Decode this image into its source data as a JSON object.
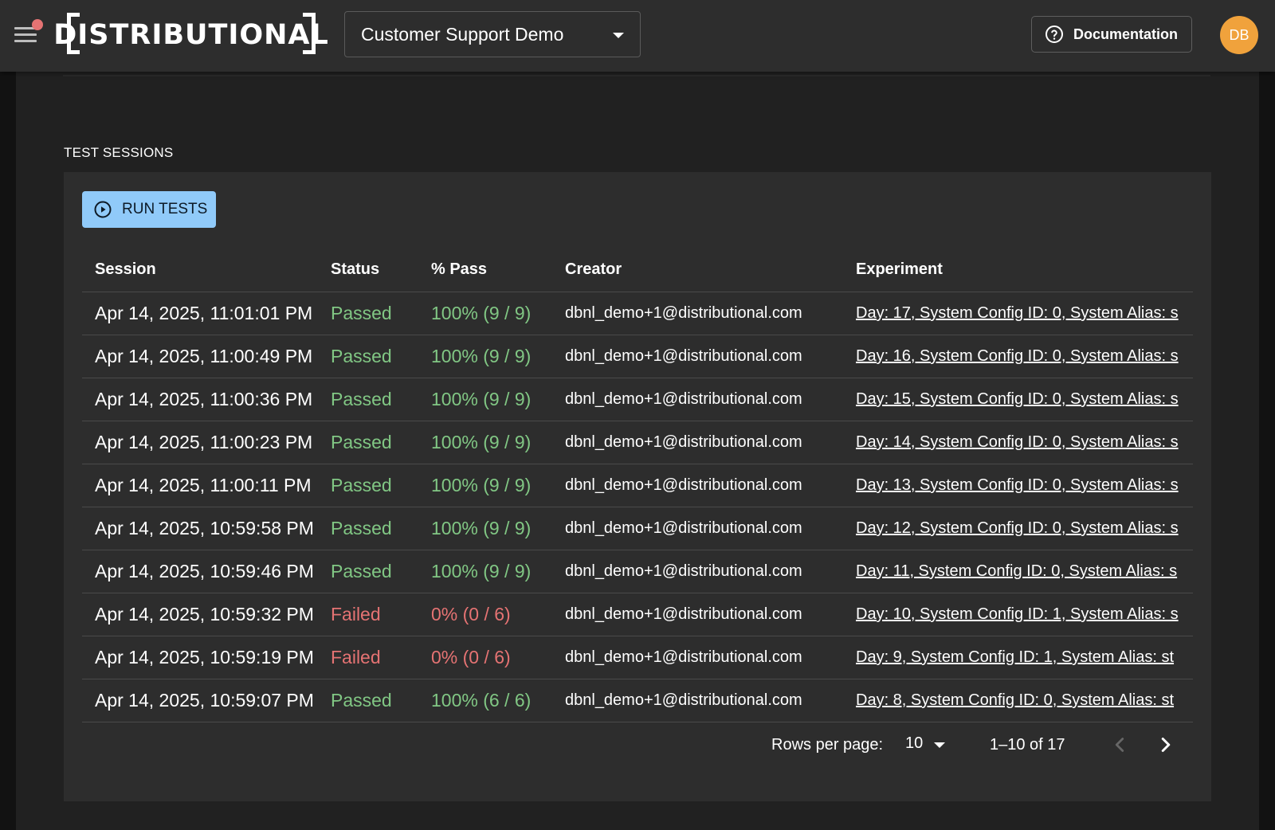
{
  "header": {
    "logo_text": "DISTRIBUTIONAL",
    "project": "Customer Support Demo",
    "docs_label": "Documentation",
    "avatar_initials": "DB"
  },
  "section": {
    "title": "TEST SESSIONS"
  },
  "run_button": {
    "label": "RUN TESTS"
  },
  "table": {
    "columns": [
      "Session",
      "Status",
      "% Pass",
      "Creator",
      "Experiment"
    ],
    "rows": [
      {
        "session": "Apr 14, 2025, 11:01:01 PM",
        "status": "Passed",
        "pass": "100% (9 / 9)",
        "creator": "dbnl_demo+1@distributional.com",
        "experiment": "Day: 17, System Config ID: 0, System Alias: s"
      },
      {
        "session": "Apr 14, 2025, 11:00:49 PM",
        "status": "Passed",
        "pass": "100% (9 / 9)",
        "creator": "dbnl_demo+1@distributional.com",
        "experiment": "Day: 16, System Config ID: 0, System Alias: s"
      },
      {
        "session": "Apr 14, 2025, 11:00:36 PM",
        "status": "Passed",
        "pass": "100% (9 / 9)",
        "creator": "dbnl_demo+1@distributional.com",
        "experiment": "Day: 15, System Config ID: 0, System Alias: s"
      },
      {
        "session": "Apr 14, 2025, 11:00:23 PM",
        "status": "Passed",
        "pass": "100% (9 / 9)",
        "creator": "dbnl_demo+1@distributional.com",
        "experiment": "Day: 14, System Config ID: 0, System Alias: s"
      },
      {
        "session": "Apr 14, 2025, 11:00:11 PM",
        "status": "Passed",
        "pass": "100% (9 / 9)",
        "creator": "dbnl_demo+1@distributional.com",
        "experiment": "Day: 13, System Config ID: 0, System Alias: s"
      },
      {
        "session": "Apr 14, 2025, 10:59:58 PM",
        "status": "Passed",
        "pass": "100% (9 / 9)",
        "creator": "dbnl_demo+1@distributional.com",
        "experiment": "Day: 12, System Config ID: 0, System Alias: s"
      },
      {
        "session": "Apr 14, 2025, 10:59:46 PM",
        "status": "Passed",
        "pass": "100% (9 / 9)",
        "creator": "dbnl_demo+1@distributional.com",
        "experiment": "Day: 11, System Config ID: 0, System Alias: s"
      },
      {
        "session": "Apr 14, 2025, 10:59:32 PM",
        "status": "Failed",
        "pass": "0% (0 / 6)",
        "creator": "dbnl_demo+1@distributional.com",
        "experiment": "Day: 10, System Config ID: 1, System Alias: s"
      },
      {
        "session": "Apr 14, 2025, 10:59:19 PM",
        "status": "Failed",
        "pass": "0% (0 / 6)",
        "creator": "dbnl_demo+1@distributional.com",
        "experiment": "Day: 9, System Config ID: 1, System Alias: st"
      },
      {
        "session": "Apr 14, 2025, 10:59:07 PM",
        "status": "Passed",
        "pass": "100% (6 / 6)",
        "creator": "dbnl_demo+1@distributional.com",
        "experiment": "Day: 8, System Config ID: 0, System Alias: st"
      }
    ]
  },
  "pagination": {
    "rows_per_page_label": "Rows per page:",
    "rows_per_page": "10",
    "range": "1–10 of 17"
  },
  "colors": {
    "passed": "#81c784",
    "failed": "#e57373",
    "accent": "#90caf9",
    "avatar": "#f0a23c"
  },
  "icons": [
    "menu-icon",
    "notification-dot",
    "help-circle-icon",
    "play-circle-icon",
    "chevron-down-icon",
    "chevron-left-icon",
    "chevron-right-icon"
  ]
}
